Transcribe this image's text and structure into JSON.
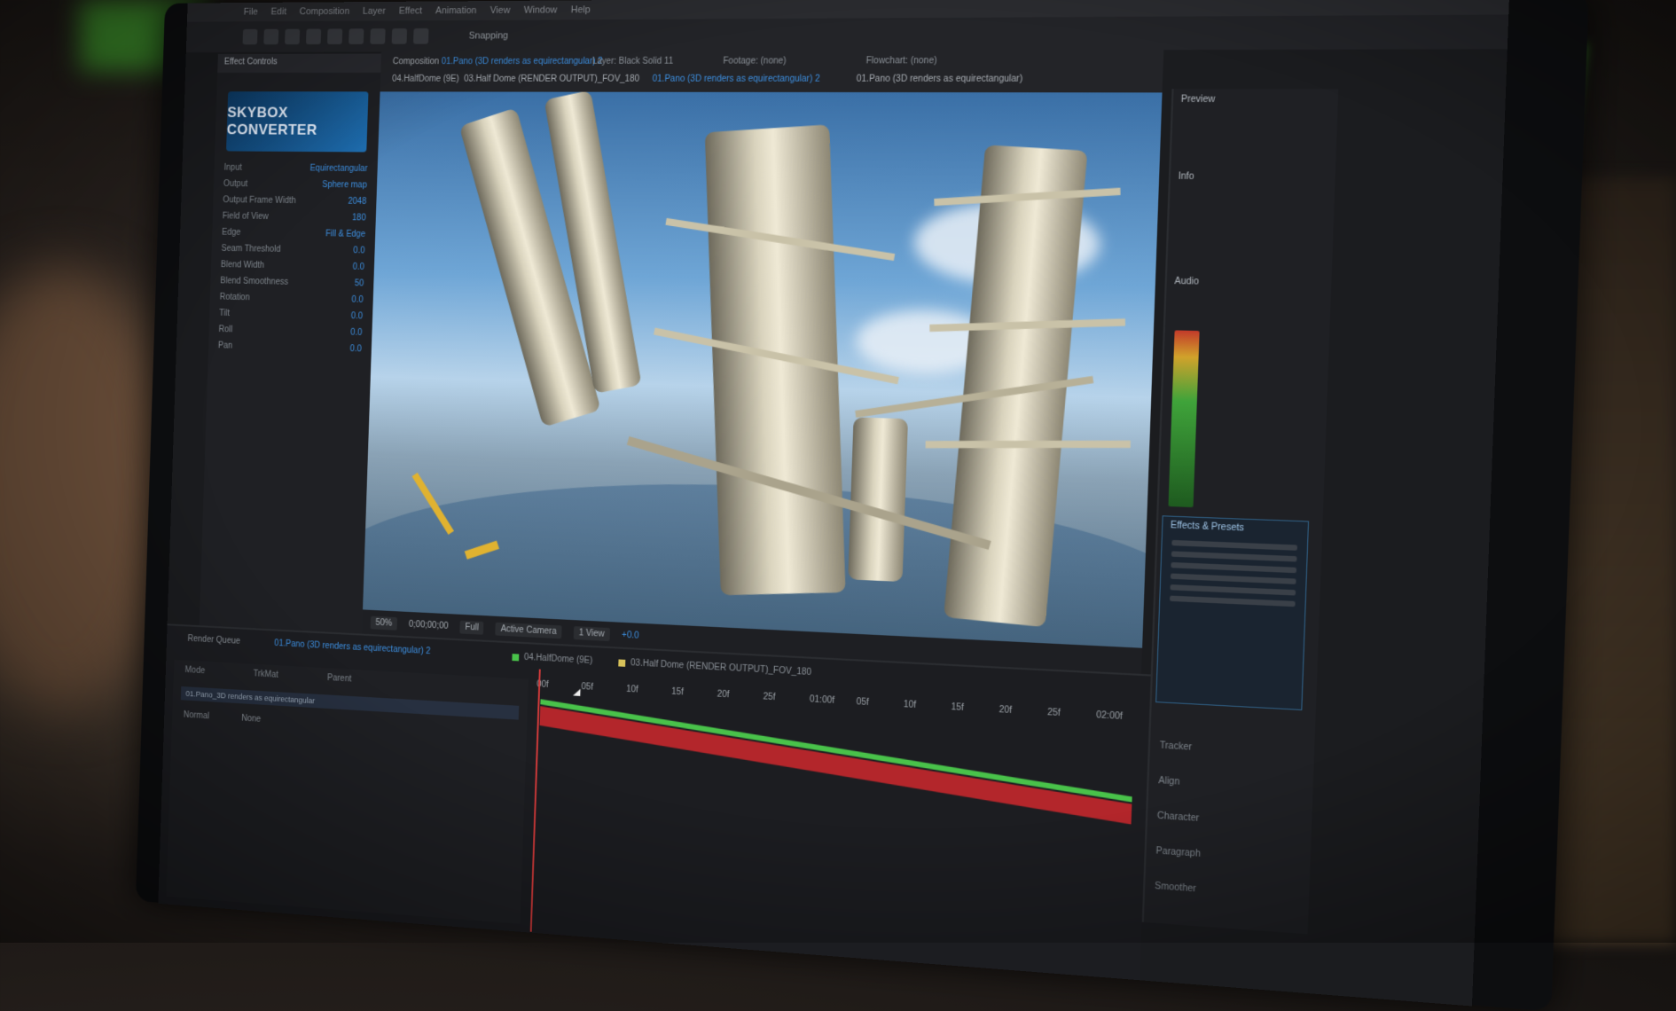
{
  "menu": [
    "File",
    "Edit",
    "Composition",
    "Layer",
    "Effect",
    "Animation",
    "View",
    "Window",
    "Help"
  ],
  "toolbar": {
    "snapping_label": "Snapping"
  },
  "effects_panel": {
    "title": "Effect Controls",
    "plugin_logo": "SKYBOX CONVERTER",
    "rows": [
      {
        "label": "Input",
        "value": "Equirectangular"
      },
      {
        "label": "Output",
        "value": "Sphere map"
      },
      {
        "label": "Output Frame Width",
        "value": "2048"
      },
      {
        "label": "Field of View",
        "value": "180"
      },
      {
        "label": "Edge",
        "value": "Fill & Edge"
      },
      {
        "label": "Seam Threshold",
        "value": "0.0"
      },
      {
        "label": "Blend Width",
        "value": "0.0"
      },
      {
        "label": "Blend Smoothness",
        "value": "50"
      },
      {
        "label": "Rotation",
        "value": "0.0"
      },
      {
        "label": "Tilt",
        "value": "0.0"
      },
      {
        "label": "Roll",
        "value": "0.0"
      },
      {
        "label": "Pan",
        "value": "0.0"
      }
    ]
  },
  "viewer": {
    "comp_tab": "Composition",
    "comp_name": "01.Pano (3D renders as equirectangular) 2",
    "layer_tab": "Layer: Black Solid 11",
    "footage_tab": "Footage: (none)",
    "flowchart_tab": "Flowchart: (none)",
    "breadcrumbs": [
      "04.HalfDome (9E)",
      "03.Half Dome (RENDER OUTPUT)_FOV_180",
      "01.Pano (3D renders as equirectangular) 2",
      "01.Pano (3D renders as equirectangular)"
    ],
    "footer": {
      "zoom": "50%",
      "timecode": "0;00;00;00",
      "resolution": "Full",
      "camera": "Active Camera",
      "views": "1 View",
      "exposure": "+0.0"
    }
  },
  "right_panel": {
    "preview": "Preview",
    "info": "Info",
    "audio": "Audio",
    "library": "Effects & Presets",
    "lines": 6,
    "bottom": [
      "Tracker",
      "Align",
      "Character",
      "Paragraph",
      "Smoother"
    ]
  },
  "timeline": {
    "tabs": [
      "Render Queue",
      "01.Pano (3D renders as equirectangular) 2"
    ],
    "comp_chips": [
      {
        "name": "04.HalfDome (9E)",
        "color": "#49c24a"
      },
      {
        "name": "03.Half Dome (RENDER OUTPUT)_FOV_180",
        "color": "#d8c25a"
      }
    ],
    "layer": {
      "name": "01.Pano_3D renders as equirectangular",
      "mode": "Normal",
      "parent": "None"
    },
    "ruler_ticks": [
      "00f",
      "05f",
      "10f",
      "15f",
      "20f",
      "25f",
      "01:00f",
      "05f",
      "10f",
      "15f",
      "20f",
      "25f",
      "02:00f"
    ],
    "parent_label": "Parent",
    "mode_label": "Mode",
    "trkmat_label": "TrkMat"
  },
  "colors": {
    "accent_blue": "#3d8fe0",
    "track_red": "#b3262b",
    "track_green": "#49c24a"
  }
}
